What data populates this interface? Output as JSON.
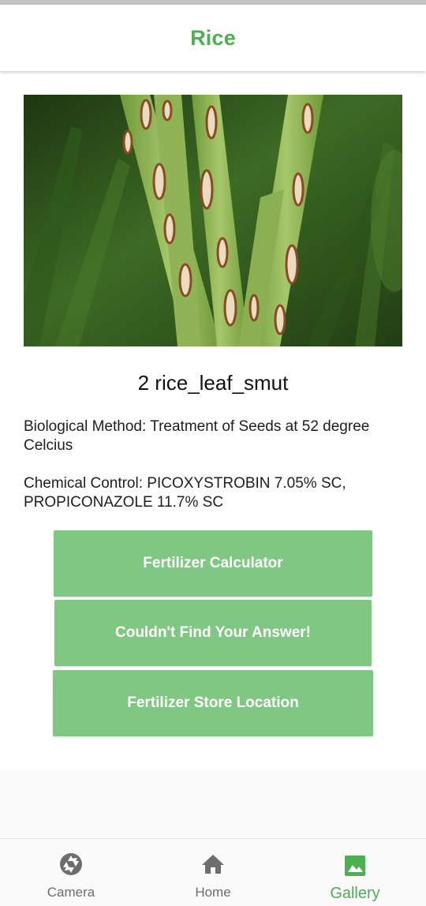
{
  "app_bar": {
    "title": "Rice"
  },
  "result": {
    "image_icon": "rice-leaf-photo",
    "disease_name": "2 rice_leaf_smut",
    "biological_method": "Biological Method: Treatment of Seeds at 52 degree Celcius",
    "chemical_control": "Chemical Control: PICOXYSTROBIN 7.05% SC, PROPICONAZOLE 11.7% SC"
  },
  "buttons": {
    "fertilizer_calculator": "Fertilizer Calculator",
    "couldnt_find_answer": "Couldn't Find Your Answer!",
    "fertilizer_store_location": "Fertilizer Store Location"
  },
  "bottom_nav": {
    "items": [
      {
        "label": "Camera",
        "icon": "camera-shutter-icon",
        "active": false
      },
      {
        "label": "Home",
        "icon": "home-icon",
        "active": false
      },
      {
        "label": "Gallery",
        "icon": "gallery-image-icon",
        "active": true
      }
    ]
  },
  "colors": {
    "accent_green": "#4caf50",
    "button_green": "#81c784",
    "inactive_nav": "#6d6d6d"
  }
}
